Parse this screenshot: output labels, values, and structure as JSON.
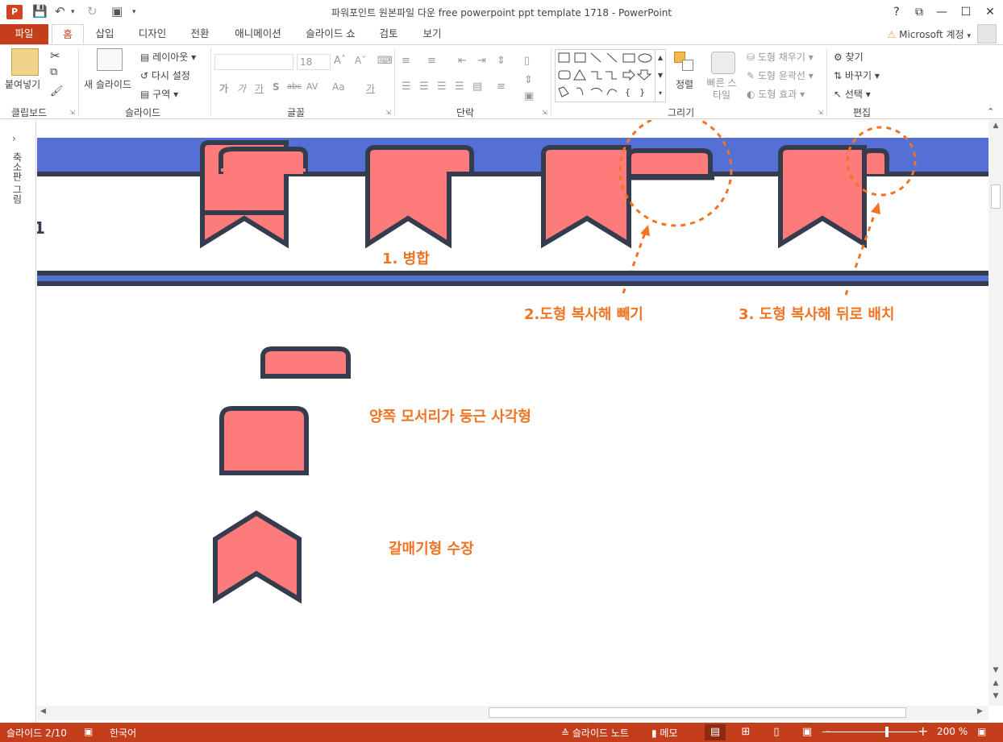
{
  "app": {
    "title": "파워포인트 원본파일 다운 free powerpoint ppt template 1718 - PowerPoint",
    "icon": "P",
    "window_buttons": [
      "?",
      "⧉",
      "—",
      "☐",
      "✕"
    ]
  },
  "tabs": [
    {
      "label": "파일"
    },
    {
      "label": "홈"
    },
    {
      "label": "삽입"
    },
    {
      "label": "디자인"
    },
    {
      "label": "전환"
    },
    {
      "label": "애니메이션"
    },
    {
      "label": "슬라이드 쇼"
    },
    {
      "label": "검토"
    },
    {
      "label": "보기"
    }
  ],
  "account": {
    "warning": "⚠",
    "label": "Microsoft 계정"
  },
  "ribbon": {
    "clipboard": {
      "paste": "붙여넣기",
      "group": "클립보드"
    },
    "slides": {
      "new_slide": "새 슬라이드",
      "layout": "레이아웃",
      "reset": "다시 설정",
      "section": "구역",
      "group": "슬라이드"
    },
    "font": {
      "size": "18",
      "group": "글꼴",
      "bold": "가",
      "italic": "가",
      "underline": "가",
      "shadow": "S",
      "strike": "abc",
      "spacing": "AV",
      "case": "Aa",
      "color": "가"
    },
    "paragraph": {
      "group": "단락"
    },
    "drawing": {
      "arrange": "정렬",
      "quick_styles": "빠른 스타일",
      "fill": "도형 채우기",
      "outline": "도형 윤곽선",
      "effects": "도형 효과",
      "group": "그리기"
    },
    "editing": {
      "find": "찾기",
      "replace": "바꾸기",
      "select": "선택",
      "group": "편집"
    }
  },
  "left_pane": {
    "label": "축소판 그림"
  },
  "slide": {
    "edge_text": "1",
    "annotations": {
      "merge": "1. 병합",
      "subtract": "2.도형 복사해 빼기",
      "send_back": "3. 도형 복사해 뒤로 배치",
      "round_rect": "양쪽 모서리가 둥근 사각형",
      "chevron": "갈매기형 수장"
    },
    "colors": {
      "band": "#5470d6",
      "fill": "#fd7b7b",
      "stroke": "#353c4d",
      "accent": "#f07423"
    }
  },
  "status": {
    "slide": "슬라이드 2/10",
    "language": "한국어",
    "notes": "슬라이드 노트",
    "comments": "메모",
    "zoom": "200 %",
    "zoom_level": 0.68
  }
}
